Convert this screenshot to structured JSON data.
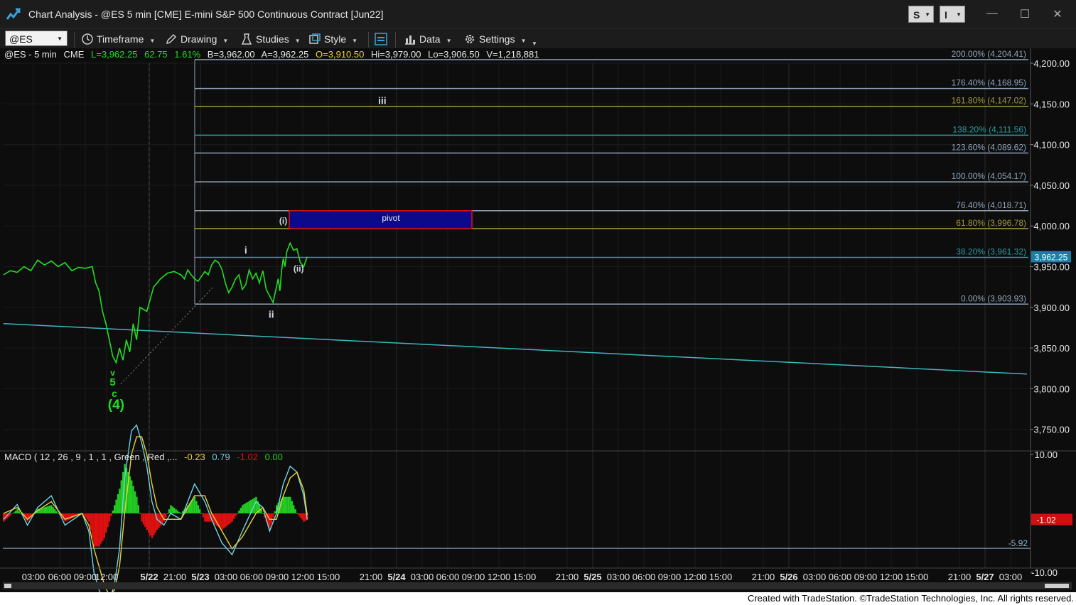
{
  "window": {
    "title": "Chart Analysis - @ES 5 min [CME] E-mini S&P 500 Continuous Contract [Jun22]",
    "s_button": "S",
    "i_button": "I",
    "minimize": "—",
    "maximize": "☐",
    "close": "✕"
  },
  "toolbar": {
    "symbol": "@ES",
    "timeframe": "Timeframe",
    "drawing": "Drawing",
    "studies": "Studies",
    "style": "Style",
    "data": "Data",
    "settings": "Settings"
  },
  "header": {
    "symbol": "@ES - 5 min",
    "exchange": "CME",
    "last": "L=3,962.25",
    "change": "62.75",
    "change_pct": "1.61%",
    "bid": "B=3,962.00",
    "ask": "A=3,962.25",
    "open": "O=3,910.50",
    "high": "Hi=3,979.00",
    "low": "Lo=3,906.50",
    "volume": "V=1,218,881"
  },
  "macd_header": {
    "label": "MACD ( 12 , 26 , 9 , 1 , 1 , Green , Red ,...",
    "v1": "-0.23",
    "v2": "0.79",
    "v3": "-1.02",
    "v4": "0.00"
  },
  "colors": {
    "background": "#0d0d0d",
    "price_line": "#22dd22",
    "fib_default": "#8fa3b8",
    "fib_gold": "#a0963c",
    "fib_teal": "#2a9aa0",
    "pivot_fill": "#0a0a8a",
    "pivot_border": "#e01010",
    "trendline": "#3bb8c0",
    "macd_line": "#6fd3e6",
    "signal_line": "#e8d23a",
    "hist_pos": "#22cc22",
    "hist_neg": "#e01010",
    "last_price_tag": "#1a7fa8",
    "macd_value_tag": "#d01010"
  },
  "chart_data": {
    "type": "line",
    "title": "@ES - 5 min",
    "xlabel": "",
    "ylabel": "",
    "ylim": [
      3725,
      4225
    ],
    "y_ticks": [
      "4,200.00",
      "4,150.00",
      "4,100.00",
      "4,050.00",
      "4,000.00",
      "3,950.00",
      "3,900.00",
      "3,850.00",
      "3,800.00",
      "3,750.00"
    ],
    "x_ticks": [
      "03:00",
      "06:00",
      "09:00",
      "12:00",
      "5/22",
      "21:00",
      "5/23",
      "03:00",
      "06:00",
      "09:00",
      "12:00",
      "15:00",
      "21:00",
      "5/24",
      "03:00",
      "06:00",
      "09:00",
      "12:00",
      "15:00",
      "21:00",
      "5/25",
      "03:00",
      "06:00",
      "09:00",
      "12:00",
      "15:00",
      "21:00",
      "5/26",
      "03:00",
      "06:00",
      "09:00",
      "12:00",
      "15:00",
      "21:00",
      "5/27",
      "03:00"
    ],
    "last_price": 3962.25,
    "last_price_label": "3,962.25",
    "series": [
      {
        "x": [
          0,
          4,
          8,
          12,
          16,
          20,
          24,
          28,
          32,
          36,
          40,
          44,
          48,
          52,
          54,
          56,
          58,
          60,
          62,
          64,
          66,
          68,
          70,
          72,
          74,
          76,
          78,
          80,
          84,
          88,
          92,
          96,
          100,
          104,
          106,
          108,
          110,
          112,
          114,
          116,
          118,
          120,
          122,
          124,
          126,
          128,
          130,
          132,
          134,
          136,
          138,
          140,
          142,
          144,
          146,
          148,
          150,
          152,
          154,
          158,
          160,
          161,
          162,
          163,
          164,
          165,
          166,
          168,
          170,
          172,
          174,
          176,
          178
        ],
        "y": [
          3940,
          3945,
          3943,
          3950,
          3945,
          3958,
          3952,
          3957,
          3950,
          3955,
          3945,
          3949,
          3948,
          3950,
          3930,
          3920,
          3895,
          3880,
          3860,
          3840,
          3832,
          3850,
          3835,
          3860,
          3845,
          3880,
          3860,
          3900,
          3895,
          3925,
          3935,
          3942,
          3944,
          3940,
          3935,
          3946,
          3940,
          3935,
          3932,
          3938,
          3944,
          3940,
          3952,
          3958,
          3955,
          3947,
          3930,
          3918,
          3925,
          3935,
          3940,
          3922,
          3928,
          3946,
          3935,
          3942,
          3930,
          3945,
          3922,
          3906,
          3925,
          3935,
          3920,
          3945,
          3960,
          3950,
          3968,
          3979,
          3970,
          3972,
          3955,
          3950,
          3962
        ]
      },
      {
        "name": "MACD",
        "x": [
          0,
          8,
          14,
          20,
          28,
          36,
          46,
          50,
          53,
          56,
          59,
          62,
          65,
          68,
          71,
          75,
          78,
          81,
          84,
          87,
          90,
          94,
          98,
          104,
          112,
          118,
          122,
          128,
          134,
          140,
          148,
          152,
          156,
          160,
          164,
          168,
          172,
          176,
          178
        ],
        "y": [
          -1,
          1.5,
          -2,
          1,
          3,
          -2,
          0,
          -3,
          -10,
          -13,
          -15,
          -15,
          -12,
          -6,
          6,
          14,
          15,
          12,
          8,
          2,
          -1,
          -2,
          0,
          -1,
          5,
          2,
          -1,
          -5,
          -7,
          -3,
          2,
          1,
          -3,
          0,
          5,
          8,
          7,
          3,
          -1.02
        ]
      },
      {
        "name": "Signal",
        "x": [
          0,
          8,
          14,
          20,
          28,
          36,
          46,
          50,
          53,
          56,
          59,
          62,
          65,
          68,
          71,
          75,
          78,
          81,
          84,
          87,
          90,
          94,
          98,
          104,
          112,
          118,
          122,
          128,
          134,
          140,
          148,
          152,
          156,
          160,
          164,
          168,
          172,
          176,
          178
        ],
        "y": [
          0,
          1,
          -1,
          0.5,
          2,
          -1,
          0,
          -2,
          -6,
          -9,
          -12,
          -14,
          -13,
          -9,
          0,
          10,
          13,
          13,
          10,
          5,
          1,
          -1,
          -1,
          -1,
          3,
          3,
          0,
          -3,
          -6,
          -4,
          0,
          1,
          -1,
          -1,
          3,
          6,
          7,
          4,
          -0.23
        ]
      }
    ],
    "macd_ylim": [
      -15.5,
      15.5
    ],
    "macd_ticks": [
      "10.00",
      "-10.00"
    ],
    "macd_reference": {
      "value": -5.92,
      "label": "-5.92"
    },
    "macd_value_label": "-1.02",
    "fib_levels": [
      {
        "value": 4204.41,
        "label": "200.00% (4,204.41)",
        "color": "#8fa3b8"
      },
      {
        "value": 4168.95,
        "label": "176.40% (4,168.95)",
        "color": "#8fa3b8"
      },
      {
        "value": 4147.02,
        "label": "161.80% (4,147.02)",
        "color": "#a0963c"
      },
      {
        "value": 4111.56,
        "label": "138.20% (4,111.56)",
        "color": "#2a9aa0"
      },
      {
        "value": 4089.62,
        "label": "123.60% (4,089.62)",
        "color": "#8fa3b8"
      },
      {
        "value": 4054.17,
        "label": "100.00% (4,054.17)",
        "color": "#8fa3b8"
      },
      {
        "value": 4018.71,
        "label": "76.40% (4,018.71)",
        "color": "#8fa3b8"
      },
      {
        "value": 3996.78,
        "label": "61.80% (3,996.78)",
        "color": "#a0963c"
      },
      {
        "value": 3961.32,
        "label": "38.20% (3,961.32)",
        "color": "#2a9aa0"
      },
      {
        "value": 3903.93,
        "label": "0.00% (3,903.93)",
        "color": "#8fa3b8"
      }
    ],
    "pivot": {
      "label": "pivot",
      "y_low": 3996.78,
      "y_high": 4018.71
    },
    "trendline": {
      "x0": 0,
      "y0": 3880,
      "x1": 1440,
      "y1": 3818
    },
    "annotations": [
      {
        "text": "i",
        "x": 142,
        "y": 3966,
        "color": "#d0d8e6",
        "size": 14
      },
      {
        "text": "ii",
        "x": 157,
        "y": 3887,
        "color": "#d0d8e6",
        "size": 14
      },
      {
        "text": "iii",
        "x": 222,
        "y": 4150,
        "color": "#d0d8e6",
        "size": 14
      },
      {
        "text": "(i)",
        "x": 164,
        "y": 4003,
        "color": "#d0d8e6",
        "size": 12
      },
      {
        "text": "(ii)",
        "x": 173,
        "y": 3944,
        "color": "#d0d8e6",
        "size": 12
      },
      {
        "text": "v",
        "x": 64,
        "y": 3816,
        "color": "#22dd22",
        "size": 12
      },
      {
        "text": "5",
        "x": 64,
        "y": 3804,
        "color": "#22dd22",
        "size": 15
      },
      {
        "text": "c",
        "x": 65,
        "y": 3790,
        "color": "#22dd22",
        "size": 14
      },
      {
        "text": "(4)",
        "x": 66,
        "y": 3775,
        "color": "#22dd22",
        "size": 19
      }
    ]
  },
  "footer": {
    "credit": "Created with TradeStation. ©TradeStation Technologies, Inc. All rights reserved."
  }
}
